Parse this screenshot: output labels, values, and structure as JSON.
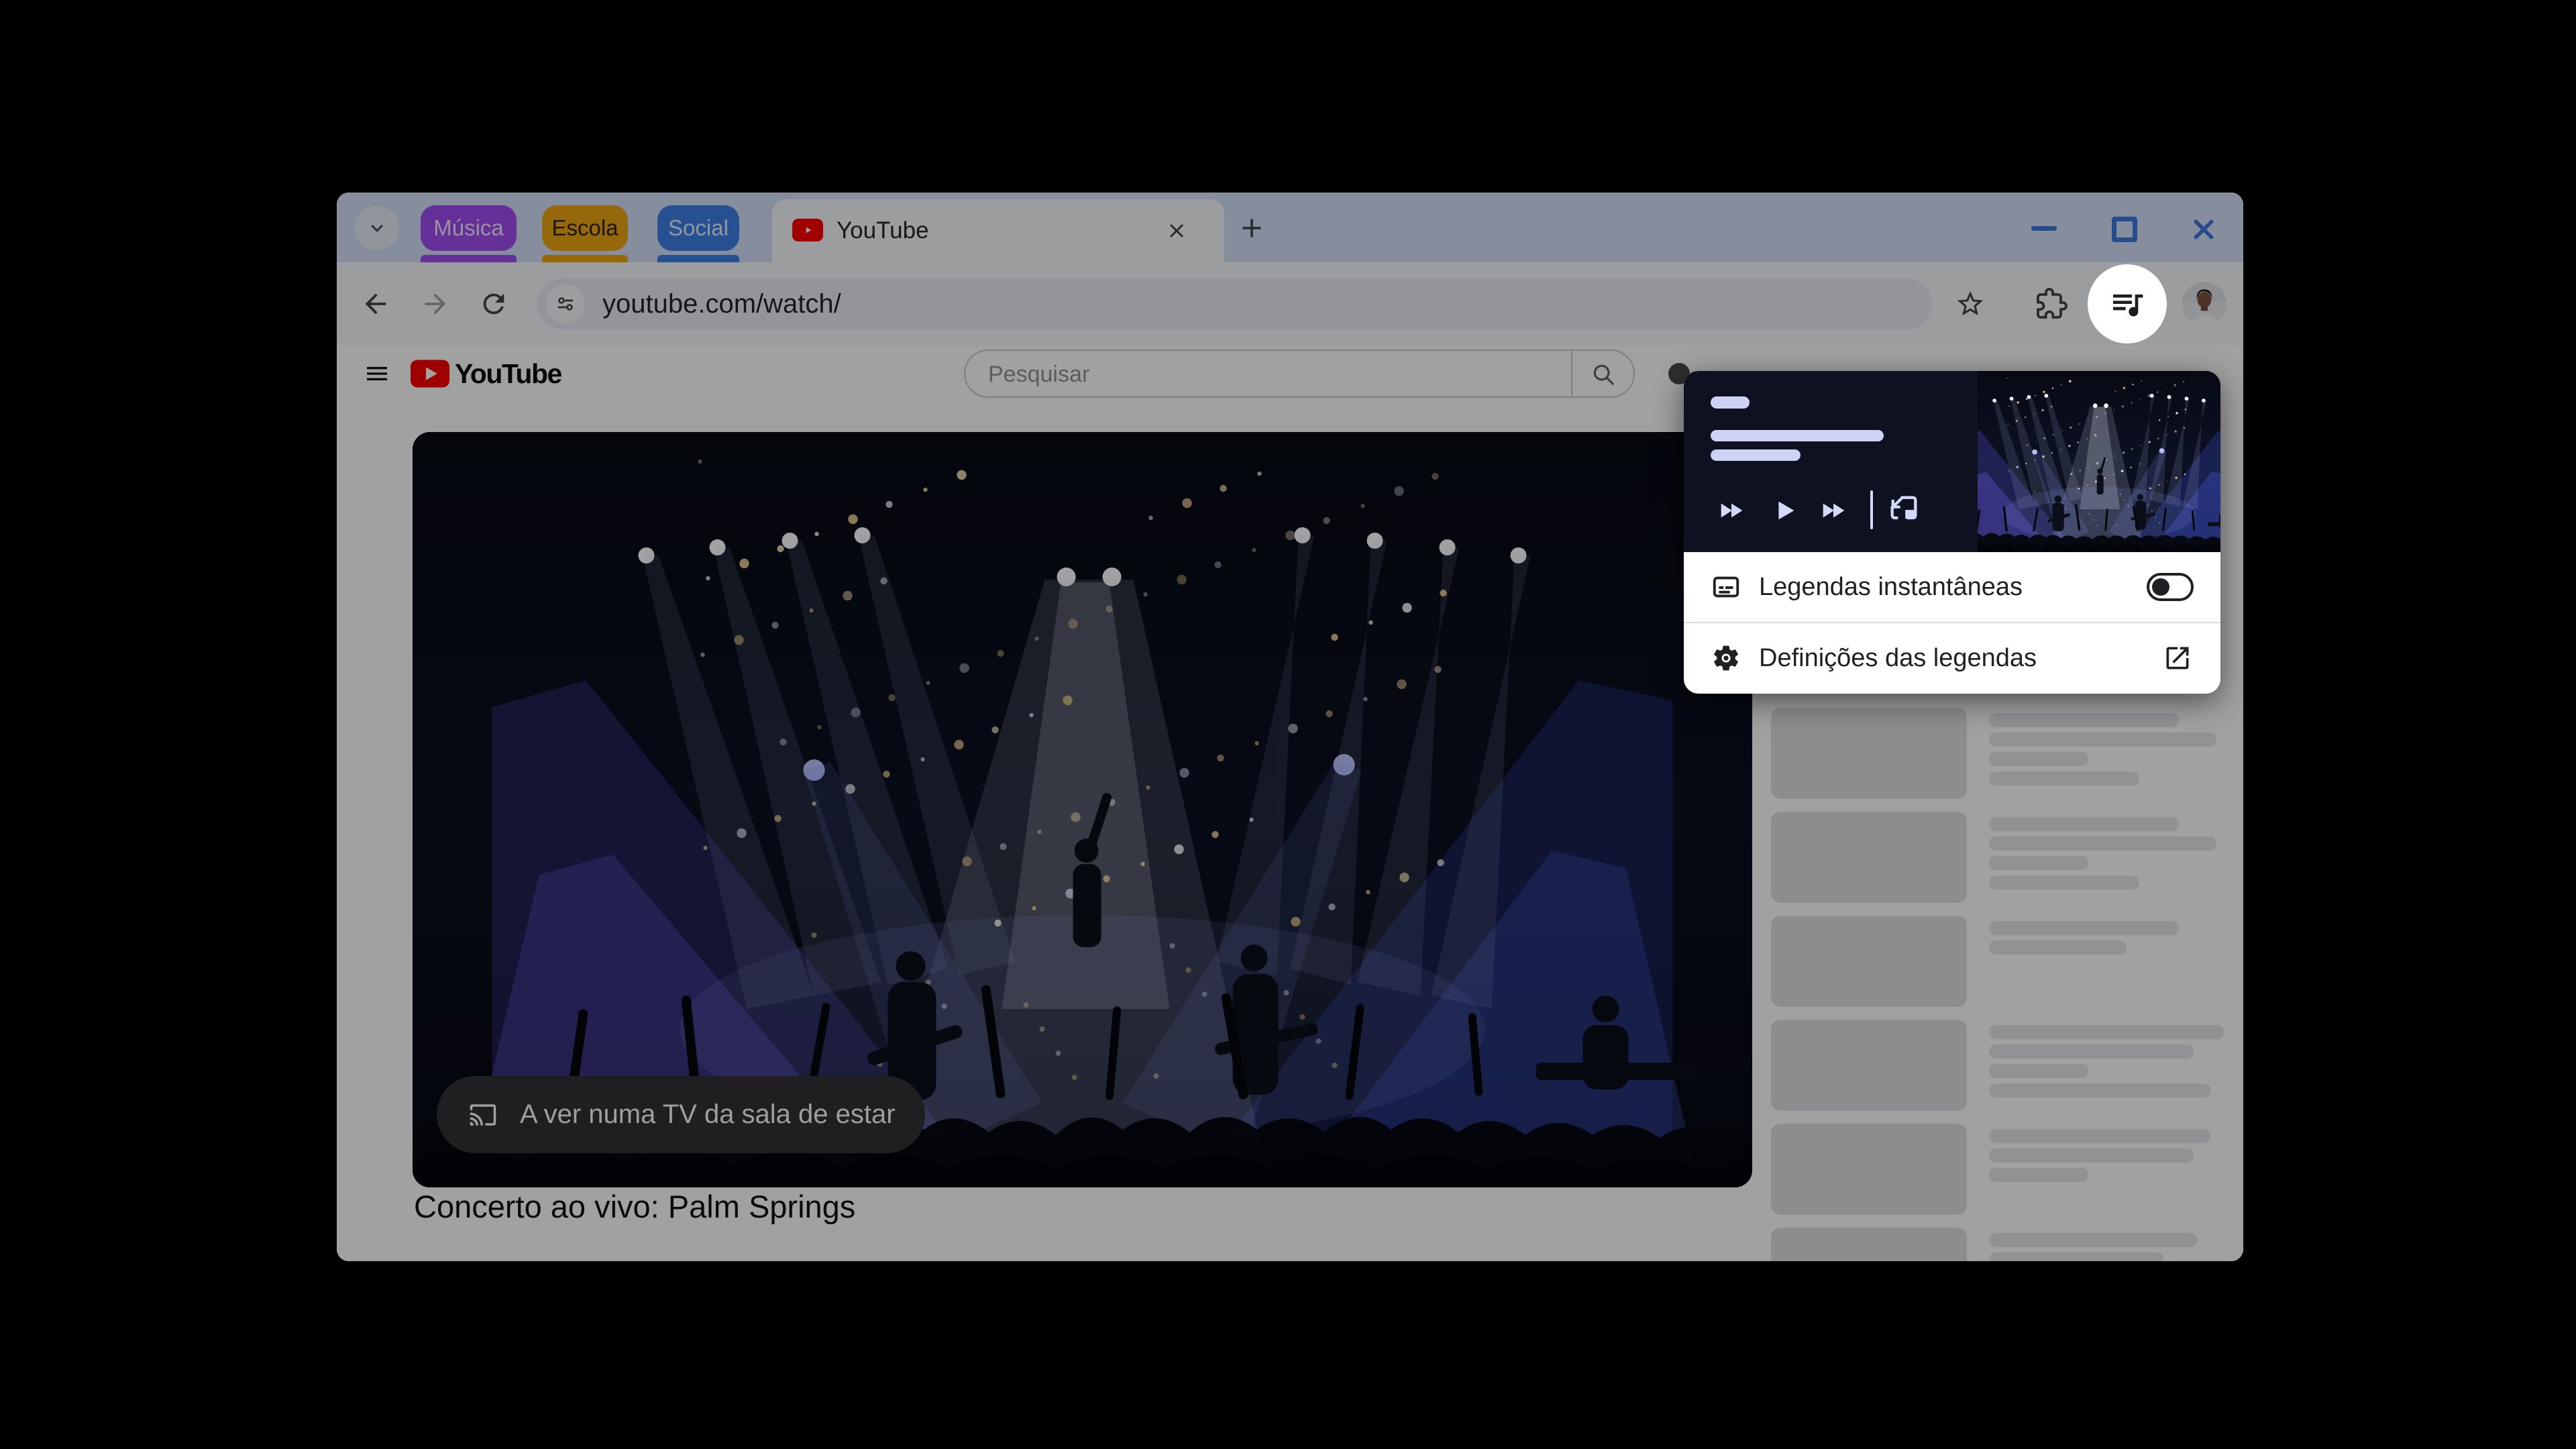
{
  "window": {
    "tab_groups": [
      {
        "label": "Música",
        "color": "#a14cf0",
        "text_color": "#f1e7ff"
      },
      {
        "label": "Escola",
        "color": "#eda712",
        "text_color": "#2c2413"
      },
      {
        "label": "Social",
        "color": "#3d7fe8",
        "text_color": "#e8f1ff"
      }
    ],
    "active_tab": {
      "title": "YouTube",
      "favicon_color": "#ff0000"
    },
    "new_tab_button": "+",
    "address_bar": {
      "url": "youtube.com/watch/"
    },
    "controls": [
      "minimize",
      "maximize",
      "close"
    ],
    "controls_color": "#3b79dd"
  },
  "youtube": {
    "search_placeholder": "Pesquisar",
    "cast_message": "A ver numa TV da sala de estar",
    "video_title": "Concerto ao vivo: Palm Springs"
  },
  "media_popup": {
    "captions_toggle_label": "Legendas instantâneas",
    "captions_toggle_state": "off",
    "captions_settings_label": "Definições das legendas",
    "card_color": "#0e1120",
    "skeleton_color": "#ccd3f5"
  },
  "sidebar_skeleton": {
    "items": [
      {
        "lines": [
          283,
          339,
          148,
          224
        ]
      },
      {
        "lines": [
          283,
          339,
          148,
          224
        ]
      },
      {
        "lines": [
          283,
          205
        ]
      },
      {
        "lines": [
          350,
          305,
          148,
          330
        ]
      },
      {
        "lines": [
          330,
          305,
          148
        ]
      },
      {
        "lines": [
          310,
          260
        ]
      }
    ]
  },
  "colors": {
    "frame": "#d4e0f8",
    "toolbar": "#f7f9fc",
    "scrim": "rgba(0,0,0,0.37)",
    "spotlight": "#ffffff",
    "youtube_red": "#ff0000"
  }
}
